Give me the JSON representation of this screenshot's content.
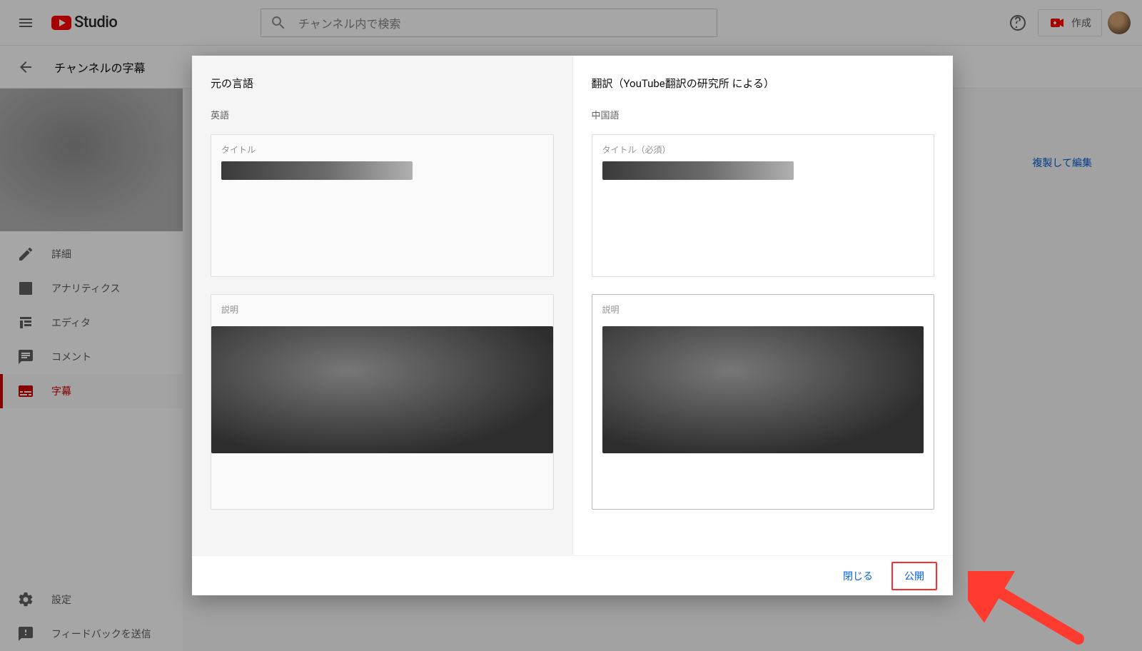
{
  "header": {
    "brand": "Studio",
    "search_placeholder": "チャンネル内で検索",
    "create_label": "作成"
  },
  "subheader": {
    "title": "チャンネルの字幕"
  },
  "sidebar": {
    "items": [
      {
        "label": "詳細"
      },
      {
        "label": "アナリティクス"
      },
      {
        "label": "エディタ"
      },
      {
        "label": "コメント"
      },
      {
        "label": "字幕"
      }
    ],
    "settings_label": "設定",
    "feedback_label": "フィードバックを送信"
  },
  "background": {
    "duplicate_edit_label": "複製して編集"
  },
  "dialog": {
    "source": {
      "heading": "元の言語",
      "language": "英語",
      "title_label": "タイトル",
      "description_label": "説明"
    },
    "translation": {
      "heading": "翻訳（YouTube翻訳の研究所 による）",
      "language": "中国語",
      "title_label": "タイトル（必須）",
      "description_label": "説明"
    },
    "close_label": "閉じる",
    "publish_label": "公開"
  }
}
